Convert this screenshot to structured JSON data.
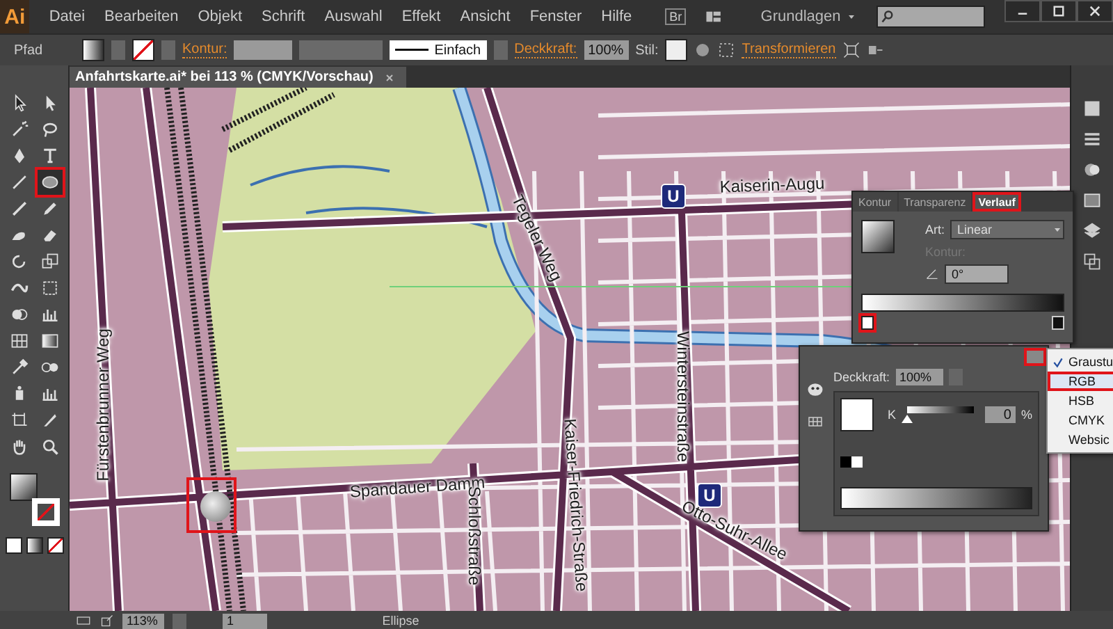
{
  "app_logo": "Ai",
  "menu": [
    "Datei",
    "Bearbeiten",
    "Objekt",
    "Schrift",
    "Auswahl",
    "Effekt",
    "Ansicht",
    "Fenster",
    "Hilfe"
  ],
  "bridge_button": "Br",
  "workspace": "Grundlagen",
  "control_bar": {
    "object_type": "Pfad",
    "stroke_label": "Kontur:",
    "stroke_style": "Einfach",
    "opacity_label": "Deckkraft:",
    "opacity": "100%",
    "style_label": "Stil:",
    "transform_link": "Transformieren"
  },
  "document_tab": {
    "title": "Anfahrtskarte.ai* bei 113 % (CMYK/Vorschau)"
  },
  "tools": [
    {
      "kind": "selection",
      "selected": false
    },
    {
      "kind": "direct-selection",
      "selected": false
    },
    {
      "kind": "magic-wand",
      "selected": false
    },
    {
      "kind": "lasso",
      "selected": false
    },
    {
      "kind": "pen",
      "selected": false
    },
    {
      "kind": "type",
      "selected": false
    },
    {
      "kind": "line",
      "selected": false
    },
    {
      "kind": "ellipse",
      "selected": true
    },
    {
      "kind": "brush",
      "selected": false
    },
    {
      "kind": "pencil",
      "selected": false
    },
    {
      "kind": "blob-brush",
      "selected": false
    },
    {
      "kind": "eraser",
      "selected": false
    },
    {
      "kind": "rotate",
      "selected": false
    },
    {
      "kind": "scale",
      "selected": false
    },
    {
      "kind": "warp",
      "selected": false
    },
    {
      "kind": "free-transform",
      "selected": false
    },
    {
      "kind": "shape-builder",
      "selected": false
    },
    {
      "kind": "graph",
      "selected": false
    },
    {
      "kind": "mesh",
      "selected": false
    },
    {
      "kind": "gradient",
      "selected": false
    },
    {
      "kind": "eyedropper",
      "selected": false
    },
    {
      "kind": "blend",
      "selected": false
    },
    {
      "kind": "symbol",
      "selected": false
    },
    {
      "kind": "graph",
      "selected": false
    },
    {
      "kind": "artboard",
      "selected": false
    },
    {
      "kind": "slice",
      "selected": false
    },
    {
      "kind": "hand",
      "selected": false
    },
    {
      "kind": "zoom",
      "selected": false
    }
  ],
  "map": {
    "labels": [
      "Fürstenbrunner Weg",
      "Spandauer Damm",
      "Tegeler Weg",
      "Wintersteinstraße",
      "Kaiser-Friedrich-Straße",
      "Schloßstraße",
      "Otto-Suhr-Allee",
      "Kaiserin-Augu"
    ],
    "stations": [
      "U",
      "U"
    ],
    "ellipse": {
      "highlighted": true
    }
  },
  "gradient_panel": {
    "tabs": [
      {
        "label": "Kontur",
        "selected": false
      },
      {
        "label": "Transparenz",
        "selected": false
      },
      {
        "label": "Verlauf",
        "selected": true
      }
    ],
    "type_label": "Art:",
    "type": "Linear",
    "stroke_label": "Kontur:",
    "angle": "0°",
    "stops": [
      {
        "highlighted": true
      },
      {
        "highlighted": false
      }
    ]
  },
  "color_panel": {
    "menu_highlighted": true,
    "opacity_label": "Deckkraft:",
    "opacity": "100%",
    "channel": "K",
    "level": 0,
    "value": "0",
    "unit": "%"
  },
  "color_mode_menu": [
    {
      "label": "Graustu",
      "checked": true,
      "selected": false
    },
    {
      "label": "RGB",
      "checked": false,
      "selected": true
    },
    {
      "label": "HSB",
      "checked": false,
      "selected": false
    },
    {
      "label": "CMYK",
      "checked": false,
      "selected": false
    },
    {
      "label": "Websic",
      "checked": false,
      "selected": false
    }
  ],
  "status_bar": {
    "zoom": "113%",
    "page": "1",
    "tool": "Ellipse"
  }
}
